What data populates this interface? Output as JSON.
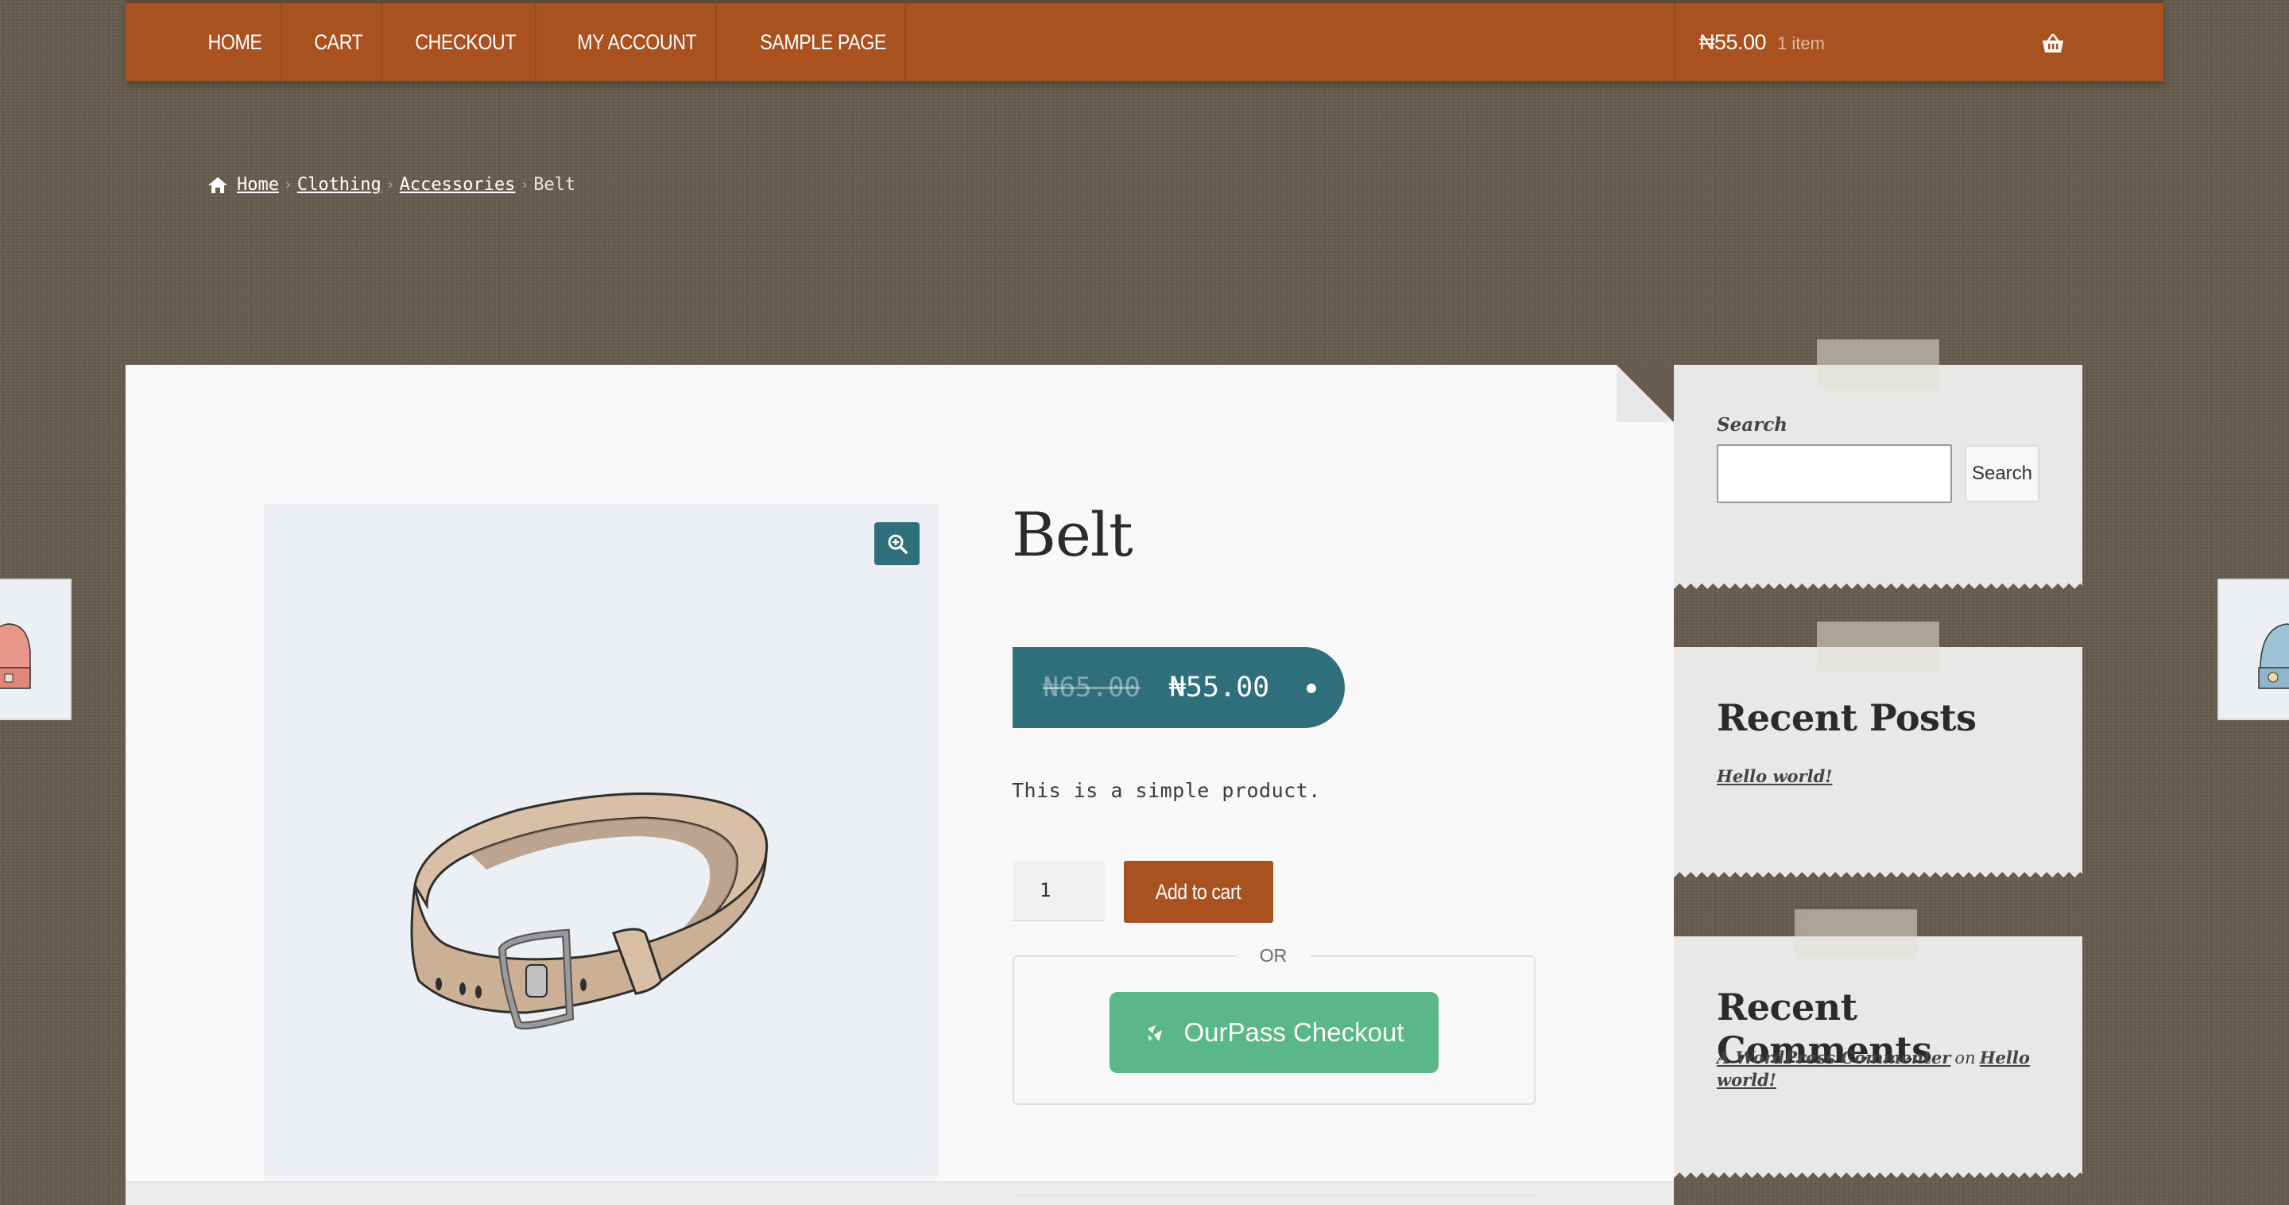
{
  "nav": {
    "items": [
      {
        "label": "HOME"
      },
      {
        "label": "CART"
      },
      {
        "label": "CHECKOUT"
      },
      {
        "label": "MY ACCOUNT"
      },
      {
        "label": "SAMPLE PAGE"
      }
    ],
    "cart": {
      "amount": "₦55.00",
      "count": "1 item",
      "icon": "basket-icon"
    }
  },
  "breadcrumb": {
    "home": "Home",
    "items": [
      "Clothing",
      "Accessories"
    ],
    "current": "Belt",
    "separator": "›"
  },
  "product": {
    "title": "Belt",
    "price_old": "₦65.00",
    "price_new": "₦55.00",
    "short_description": "This is a simple product.",
    "quantity": "1",
    "add_to_cart_label": "Add to cart",
    "or_label": "OR",
    "ourpass_label": "OurPass Checkout",
    "image_icon": "zoom-icon"
  },
  "sidebar": {
    "search": {
      "label": "Search",
      "button": "Search",
      "placeholder": ""
    },
    "recent_posts": {
      "title": "Recent Posts",
      "items": [
        "Hello world!"
      ]
    },
    "recent_comments": {
      "title": "Recent Comments",
      "author": "A WordPress Commenter",
      "on": "on",
      "post": "Hello world!"
    }
  },
  "colors": {
    "background": "#665c4e",
    "nav": "#a9511f",
    "accent": "#2f6f7c",
    "ourpass": "#59b886"
  }
}
